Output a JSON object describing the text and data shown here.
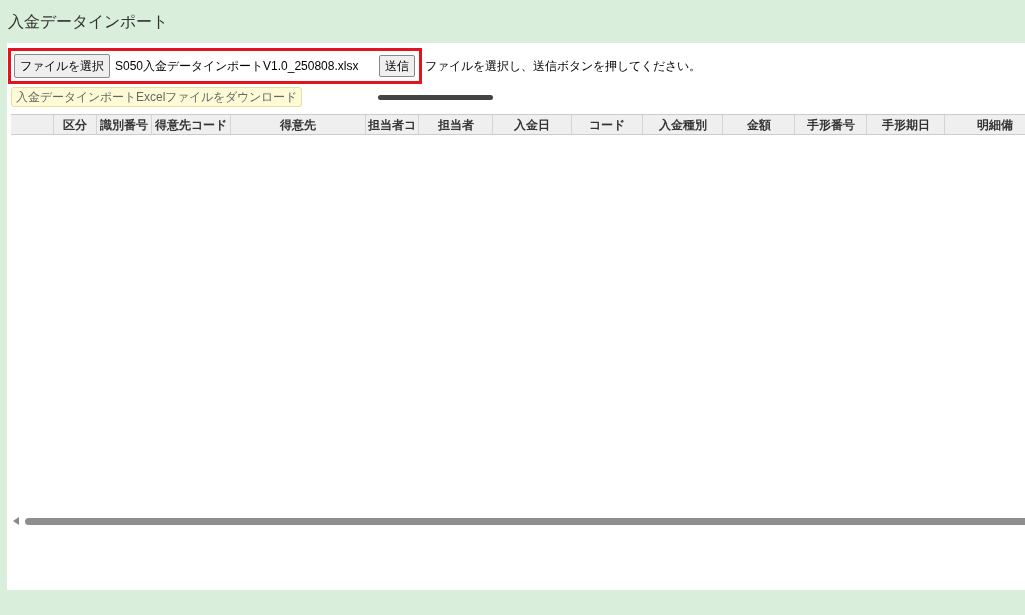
{
  "page_title": "入金データインポート",
  "upload": {
    "choose_button": "ファイルを選択",
    "file_name": "S050入金データインポートV1.0_250808.xlsx",
    "send_button": "送信",
    "instruction": "ファイルを選択し、送信ボタンを押してください。"
  },
  "download_link": "入金データインポートExcelファイルをダウンロード",
  "table": {
    "columns": [
      "区分",
      "識別番号",
      "得意先コード",
      "得意先",
      "担当者コ",
      "担当者",
      "入金日",
      "コード",
      "入金種別",
      "金額",
      "手形番号",
      "手形期日",
      "明細備"
    ]
  }
}
